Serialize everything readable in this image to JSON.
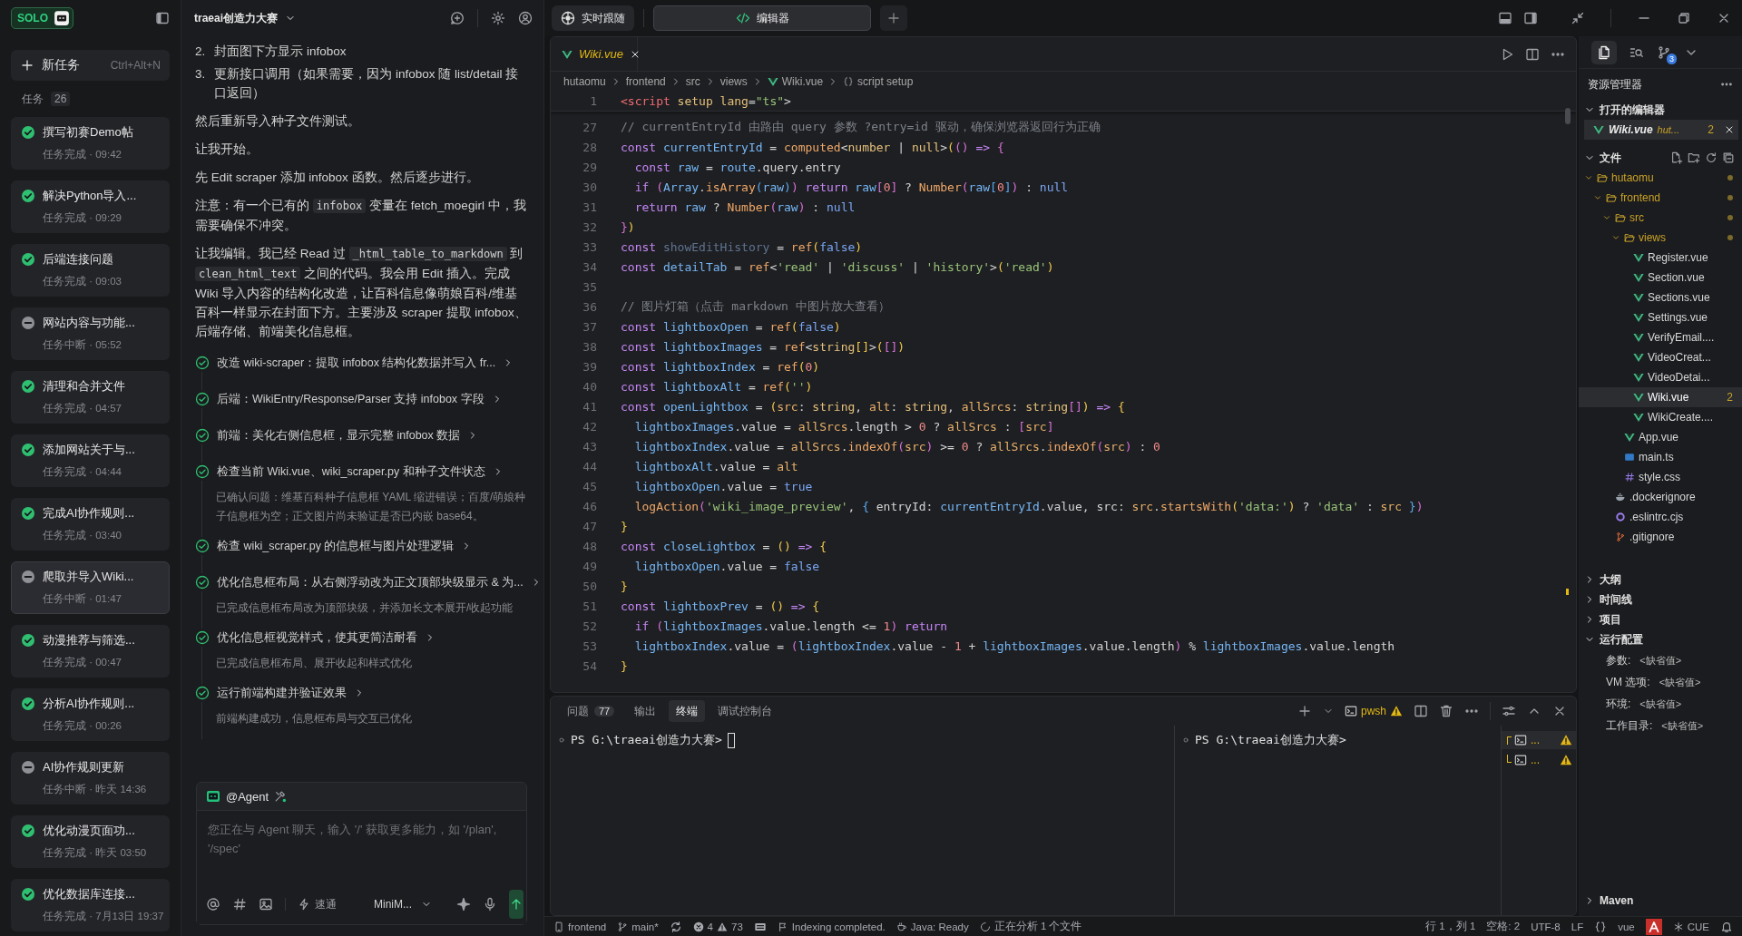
{
  "sidebar": {
    "logo": "SOLO",
    "new_task": {
      "label": "新任务",
      "shortcut": "Ctrl+Alt+N"
    },
    "tasks_label": "任务",
    "tasks_count": "26",
    "tasks": [
      {
        "title": "撰写初赛Demo帖",
        "kind": "done",
        "subtitle": "任务完成 · 09:42",
        "selected": false
      },
      {
        "title": "解决Python导入...",
        "kind": "done",
        "subtitle": "任务完成 · 09:29",
        "selected": false
      },
      {
        "title": "后端连接问题",
        "kind": "done",
        "subtitle": "任务完成 · 09:03",
        "selected": false
      },
      {
        "title": "网站内容与功能...",
        "kind": "interrupted",
        "subtitle": "任务中断 · 05:52",
        "selected": false
      },
      {
        "title": "清理和合并文件",
        "kind": "done",
        "subtitle": "任务完成 · 04:57",
        "selected": false
      },
      {
        "title": "添加网站关于与...",
        "kind": "done",
        "subtitle": "任务完成 · 04:44",
        "selected": false
      },
      {
        "title": "完成AI协作规则...",
        "kind": "done",
        "subtitle": "任务完成 · 03:40",
        "selected": false
      },
      {
        "title": "爬取并导入Wiki...",
        "kind": "interrupted",
        "subtitle": "任务中断 · 01:47",
        "selected": true
      },
      {
        "title": "动漫推荐与筛选...",
        "kind": "done",
        "subtitle": "任务完成 · 00:47",
        "selected": false
      },
      {
        "title": "分析AI协作规则...",
        "kind": "done",
        "subtitle": "任务完成 · 00:26",
        "selected": false
      },
      {
        "title": "AI协作规则更新",
        "kind": "interrupted",
        "subtitle": "任务中断 · 昨天 14:36",
        "selected": false
      },
      {
        "title": "优化动漫页面功...",
        "kind": "done",
        "subtitle": "任务完成 · 昨天 03:50",
        "selected": false
      },
      {
        "title": "优化数据库连接...",
        "kind": "done",
        "subtitle": "任务完成 · 7月13日 19:37",
        "selected": false
      }
    ]
  },
  "chat": {
    "title": "traeai创造力大赛",
    "messages": [
      {
        "kind": "numbered",
        "number": "2.",
        "text": "封面图下方显示 infobox"
      },
      {
        "kind": "numbered",
        "number": "3.",
        "text": "更新接口调用（如果需要，因为 infobox 随 list/detail 接口返回）"
      },
      {
        "kind": "paragraph",
        "parts": [
          {
            "kind": "text",
            "text": "然后重新导入种子文件测试。"
          }
        ]
      },
      {
        "kind": "paragraph",
        "parts": [
          {
            "kind": "text",
            "text": "让我开始。"
          }
        ]
      },
      {
        "kind": "paragraph",
        "parts": [
          {
            "kind": "text",
            "text": "先 Edit scraper 添加 infobox 函数。然后逐步进行。"
          }
        ]
      },
      {
        "kind": "paragraph",
        "parts": [
          {
            "kind": "text",
            "text": "注意：有一个已有的 "
          },
          {
            "kind": "code",
            "text": "infobox"
          },
          {
            "kind": "text",
            "text": " 变量在 fetch_moegirl 中，我需要确保不冲突。"
          }
        ]
      },
      {
        "kind": "paragraph",
        "parts": [
          {
            "kind": "text",
            "text": "让我编辑。我已经 Read 过 "
          },
          {
            "kind": "code",
            "text": "_html_table_to_markdown"
          },
          {
            "kind": "text",
            "text": " 到 "
          },
          {
            "kind": "code",
            "text": "clean_html_text"
          },
          {
            "kind": "text",
            "text": " 之间的代码。我会用 Edit 插入。完成 Wiki 导入内容的结构化改造，让百科信息像萌娘百科/维基百科一样显示在封面下方。主要涉及 scraper 提取 infobox、后端存储、前端美化信息框。"
          }
        ]
      }
    ],
    "steps": [
      {
        "title": "改造 wiki-scraper：提取 infobox 结构化数据并写入 fr..."
      },
      {
        "title": "后端：WikiEntry/Response/Parser 支持 infobox 字段"
      },
      {
        "title": "前端：美化右侧信息框，显示完整 infobox 数据"
      },
      {
        "title": "检查当前 Wiki.vue、wiki_scraper.py 和种子文件状态",
        "detail": "已确认问题：维基百科种子信息框 YAML 缩进错误；百度/萌娘种子信息框为空；正文图片尚未验证是否已内嵌 base64。"
      },
      {
        "title": "检查 wiki_scraper.py 的信息框与图片处理逻辑"
      },
      {
        "title": "优化信息框布局：从右侧浮动改为正文顶部块级显示 & 为...",
        "detail": "已完成信息框布局改为顶部块级，并添加长文本展开/收起功能"
      },
      {
        "title": "优化信息框视觉样式，使其更简洁耐看",
        "detail": "已完成信息框布局、展开收起和样式优化"
      },
      {
        "title": "运行前端构建并验证效果",
        "detail": "前端构建成功，信息框布局与交互已优化"
      }
    ],
    "composer": {
      "agent": "@Agent",
      "placeholder": "您正在与 Agent 聊天，输入 '/' 获取更多能力，如 '/plan', '/spec'",
      "mode": "速通",
      "model": "MiniM..."
    }
  },
  "top_bar": {
    "follow": "实时跟随",
    "tabs": [
      {
        "label": "编辑器",
        "selected": true
      }
    ]
  },
  "editor": {
    "tab": "Wiki.vue",
    "breadcrumb": [
      {
        "kind": "folder",
        "text": "hutaomu"
      },
      {
        "kind": "folder",
        "text": "frontend"
      },
      {
        "kind": "folder",
        "text": "src"
      },
      {
        "kind": "folder",
        "text": "views"
      },
      {
        "kind": "file",
        "text": "Wiki.vue"
      },
      {
        "kind": "symbol",
        "text": "script setup"
      }
    ],
    "sticky_line": {
      "number": "1",
      "tokens": [
        {
          "kind": "tg",
          "text": "<script"
        },
        {
          "kind": "at",
          "text": " setup"
        },
        {
          "kind": "at",
          "text": " lang"
        },
        {
          "kind": "p",
          "text": "="
        },
        {
          "kind": "s",
          "text": "\"ts\""
        },
        {
          "kind": "p",
          "text": ">"
        }
      ]
    },
    "lines": [
      {
        "number": "27",
        "tokens": [
          {
            "kind": "c",
            "text": "// currentEntryId 由路由 query 参数 ?entry=id 驱动，确保浏览器返回行为正确"
          }
        ]
      },
      {
        "number": "28",
        "tokens": [
          {
            "kind": "kw",
            "text": "const "
          },
          {
            "kind": "v",
            "text": "currentEntryId"
          },
          {
            "kind": "p",
            "text": " = "
          },
          {
            "kind": "f",
            "text": "computed"
          },
          {
            "kind": "p",
            "text": "<"
          },
          {
            "kind": "ty",
            "text": "number"
          },
          {
            "kind": "p",
            "text": " | "
          },
          {
            "kind": "ty",
            "text": "null"
          },
          {
            "kind": "p",
            "text": ">"
          },
          {
            "kind": "b1",
            "text": "("
          },
          {
            "kind": "b2",
            "text": "()"
          },
          {
            "kind": "kw",
            "text": " => "
          },
          {
            "kind": "b2",
            "text": "{"
          }
        ]
      },
      {
        "number": "29",
        "tokens": [
          {
            "kind": "kw",
            "text": "  const "
          },
          {
            "kind": "v",
            "text": "raw"
          },
          {
            "kind": "p",
            "text": " = "
          },
          {
            "kind": "v",
            "text": "route"
          },
          {
            "kind": "p",
            "text": ".query.entry"
          }
        ]
      },
      {
        "number": "30",
        "tokens": [
          {
            "kind": "kw",
            "text": "  if "
          },
          {
            "kind": "b2",
            "text": "("
          },
          {
            "kind": "v",
            "text": "Array"
          },
          {
            "kind": "p",
            "text": "."
          },
          {
            "kind": "f",
            "text": "isArray"
          },
          {
            "kind": "b3",
            "text": "("
          },
          {
            "kind": "v",
            "text": "raw"
          },
          {
            "kind": "b3",
            "text": ")"
          },
          {
            "kind": "b2",
            "text": ")"
          },
          {
            "kind": "kw",
            "text": " return "
          },
          {
            "kind": "v",
            "text": "raw"
          },
          {
            "kind": "b2",
            "text": "["
          },
          {
            "kind": "n",
            "text": "0"
          },
          {
            "kind": "b2",
            "text": "]"
          },
          {
            "kind": "p",
            "text": " ? "
          },
          {
            "kind": "f",
            "text": "Number"
          },
          {
            "kind": "b2",
            "text": "("
          },
          {
            "kind": "v",
            "text": "raw"
          },
          {
            "kind": "b3",
            "text": "["
          },
          {
            "kind": "n",
            "text": "0"
          },
          {
            "kind": "b3",
            "text": "]"
          },
          {
            "kind": "b2",
            "text": ")"
          },
          {
            "kind": "p",
            "text": " : "
          },
          {
            "kind": "l",
            "text": "null"
          }
        ]
      },
      {
        "number": "31",
        "tokens": [
          {
            "kind": "kw",
            "text": "  return "
          },
          {
            "kind": "v",
            "text": "raw"
          },
          {
            "kind": "p",
            "text": " ? "
          },
          {
            "kind": "f",
            "text": "Number"
          },
          {
            "kind": "b2",
            "text": "("
          },
          {
            "kind": "v",
            "text": "raw"
          },
          {
            "kind": "b2",
            "text": ")"
          },
          {
            "kind": "p",
            "text": " : "
          },
          {
            "kind": "l",
            "text": "null"
          }
        ]
      },
      {
        "number": "32",
        "tokens": [
          {
            "kind": "b2",
            "text": "}"
          },
          {
            "kind": "b1",
            "text": ")"
          }
        ]
      },
      {
        "number": "33",
        "tokens": [
          {
            "kind": "kw",
            "text": "const "
          },
          {
            "kind": "d",
            "text": "showEditHistory"
          },
          {
            "kind": "p",
            "text": " = "
          },
          {
            "kind": "f",
            "text": "ref"
          },
          {
            "kind": "b1",
            "text": "("
          },
          {
            "kind": "l",
            "text": "false"
          },
          {
            "kind": "b1",
            "text": ")"
          }
        ]
      },
      {
        "number": "34",
        "tokens": [
          {
            "kind": "kw",
            "text": "const "
          },
          {
            "kind": "v",
            "text": "detailTab"
          },
          {
            "kind": "p",
            "text": " = "
          },
          {
            "kind": "f",
            "text": "ref"
          },
          {
            "kind": "p",
            "text": "<"
          },
          {
            "kind": "s",
            "text": "'read'"
          },
          {
            "kind": "p",
            "text": " | "
          },
          {
            "kind": "s",
            "text": "'discuss'"
          },
          {
            "kind": "p",
            "text": " | "
          },
          {
            "kind": "s",
            "text": "'history'"
          },
          {
            "kind": "p",
            "text": ">"
          },
          {
            "kind": "b1",
            "text": "("
          },
          {
            "kind": "s",
            "text": "'read'"
          },
          {
            "kind": "b1",
            "text": ")"
          }
        ]
      },
      {
        "number": "35"
      },
      {
        "number": "36",
        "tokens": [
          {
            "kind": "c",
            "text": "// 图片灯箱（点击 markdown 中图片放大查看）"
          }
        ]
      },
      {
        "number": "37",
        "tokens": [
          {
            "kind": "kw",
            "text": "const "
          },
          {
            "kind": "v",
            "text": "lightboxOpen"
          },
          {
            "kind": "p",
            "text": " = "
          },
          {
            "kind": "f",
            "text": "ref"
          },
          {
            "kind": "b1",
            "text": "("
          },
          {
            "kind": "l",
            "text": "false"
          },
          {
            "kind": "b1",
            "text": ")"
          }
        ]
      },
      {
        "number": "38",
        "tokens": [
          {
            "kind": "kw",
            "text": "const "
          },
          {
            "kind": "v",
            "text": "lightboxImages"
          },
          {
            "kind": "p",
            "text": " = "
          },
          {
            "kind": "f",
            "text": "ref"
          },
          {
            "kind": "p",
            "text": "<"
          },
          {
            "kind": "ty",
            "text": "string"
          },
          {
            "kind": "b1",
            "text": "[]"
          },
          {
            "kind": "p",
            "text": ">"
          },
          {
            "kind": "b1",
            "text": "("
          },
          {
            "kind": "b2",
            "text": "[]"
          },
          {
            "kind": "b1",
            "text": ")"
          }
        ]
      },
      {
        "number": "39",
        "tokens": [
          {
            "kind": "kw",
            "text": "const "
          },
          {
            "kind": "v",
            "text": "lightboxIndex"
          },
          {
            "kind": "p",
            "text": " = "
          },
          {
            "kind": "f",
            "text": "ref"
          },
          {
            "kind": "b1",
            "text": "("
          },
          {
            "kind": "n",
            "text": "0"
          },
          {
            "kind": "b1",
            "text": ")"
          }
        ]
      },
      {
        "number": "40",
        "tokens": [
          {
            "kind": "kw",
            "text": "const "
          },
          {
            "kind": "v",
            "text": "lightboxAlt"
          },
          {
            "kind": "p",
            "text": " = "
          },
          {
            "kind": "f",
            "text": "ref"
          },
          {
            "kind": "b1",
            "text": "("
          },
          {
            "kind": "s",
            "text": "''"
          },
          {
            "kind": "b1",
            "text": ")"
          }
        ]
      },
      {
        "number": "41",
        "tokens": [
          {
            "kind": "kw",
            "text": "const "
          },
          {
            "kind": "v",
            "text": "openLightbox"
          },
          {
            "kind": "p",
            "text": " = "
          },
          {
            "kind": "b1",
            "text": "("
          },
          {
            "kind": "pr",
            "text": "src"
          },
          {
            "kind": "p",
            "text": ": "
          },
          {
            "kind": "ty",
            "text": "string"
          },
          {
            "kind": "p",
            "text": ", "
          },
          {
            "kind": "pr",
            "text": "alt"
          },
          {
            "kind": "p",
            "text": ": "
          },
          {
            "kind": "ty",
            "text": "string"
          },
          {
            "kind": "p",
            "text": ", "
          },
          {
            "kind": "pr",
            "text": "allSrcs"
          },
          {
            "kind": "p",
            "text": ": "
          },
          {
            "kind": "ty",
            "text": "string"
          },
          {
            "kind": "b2",
            "text": "[]"
          },
          {
            "kind": "b1",
            "text": ")"
          },
          {
            "kind": "kw",
            "text": " => "
          },
          {
            "kind": "b1",
            "text": "{"
          }
        ]
      },
      {
        "number": "42",
        "tokens": [
          {
            "kind": "v",
            "text": "  lightboxImages"
          },
          {
            "kind": "p",
            "text": ".value = "
          },
          {
            "kind": "pr",
            "text": "allSrcs"
          },
          {
            "kind": "p",
            "text": ".length > "
          },
          {
            "kind": "n",
            "text": "0"
          },
          {
            "kind": "p",
            "text": " ? "
          },
          {
            "kind": "pr",
            "text": "allSrcs"
          },
          {
            "kind": "p",
            "text": " : "
          },
          {
            "kind": "b2",
            "text": "["
          },
          {
            "kind": "pr",
            "text": "src"
          },
          {
            "kind": "b2",
            "text": "]"
          }
        ]
      },
      {
        "number": "43",
        "tokens": [
          {
            "kind": "v",
            "text": "  lightboxIndex"
          },
          {
            "kind": "p",
            "text": ".value = "
          },
          {
            "kind": "pr",
            "text": "allSrcs"
          },
          {
            "kind": "p",
            "text": "."
          },
          {
            "kind": "f",
            "text": "indexOf"
          },
          {
            "kind": "b2",
            "text": "("
          },
          {
            "kind": "pr",
            "text": "src"
          },
          {
            "kind": "b2",
            "text": ")"
          },
          {
            "kind": "p",
            "text": " >= "
          },
          {
            "kind": "n",
            "text": "0"
          },
          {
            "kind": "p",
            "text": " ? "
          },
          {
            "kind": "pr",
            "text": "allSrcs"
          },
          {
            "kind": "p",
            "text": "."
          },
          {
            "kind": "f",
            "text": "indexOf"
          },
          {
            "kind": "b2",
            "text": "("
          },
          {
            "kind": "pr",
            "text": "src"
          },
          {
            "kind": "b2",
            "text": ")"
          },
          {
            "kind": "p",
            "text": " : "
          },
          {
            "kind": "n",
            "text": "0"
          }
        ]
      },
      {
        "number": "44",
        "tokens": [
          {
            "kind": "v",
            "text": "  lightboxAlt"
          },
          {
            "kind": "p",
            "text": ".value = "
          },
          {
            "kind": "pr",
            "text": "alt"
          }
        ]
      },
      {
        "number": "45",
        "tokens": [
          {
            "kind": "v",
            "text": "  lightboxOpen"
          },
          {
            "kind": "p",
            "text": ".value = "
          },
          {
            "kind": "l",
            "text": "true"
          }
        ]
      },
      {
        "number": "46",
        "tokens": [
          {
            "kind": "f",
            "text": "  logAction"
          },
          {
            "kind": "b2",
            "text": "("
          },
          {
            "kind": "s",
            "text": "'wiki_image_preview'"
          },
          {
            "kind": "p",
            "text": ", "
          },
          {
            "kind": "b3",
            "text": "{"
          },
          {
            "kind": "p",
            "text": " entryId: "
          },
          {
            "kind": "v",
            "text": "currentEntryId"
          },
          {
            "kind": "p",
            "text": ".value, src: "
          },
          {
            "kind": "pr",
            "text": "src"
          },
          {
            "kind": "p",
            "text": "."
          },
          {
            "kind": "f",
            "text": "startsWith"
          },
          {
            "kind": "b1",
            "text": "("
          },
          {
            "kind": "s",
            "text": "'data:'"
          },
          {
            "kind": "b1",
            "text": ")"
          },
          {
            "kind": "p",
            "text": " ? "
          },
          {
            "kind": "s",
            "text": "'data'"
          },
          {
            "kind": "p",
            "text": " : "
          },
          {
            "kind": "pr",
            "text": "src"
          },
          {
            "kind": "b3",
            "text": " }"
          },
          {
            "kind": "b2",
            "text": ")"
          }
        ]
      },
      {
        "number": "47",
        "tokens": [
          {
            "kind": "b1",
            "text": "}"
          }
        ]
      },
      {
        "number": "48",
        "tokens": [
          {
            "kind": "kw",
            "text": "const "
          },
          {
            "kind": "v",
            "text": "closeLightbox"
          },
          {
            "kind": "p",
            "text": " = "
          },
          {
            "kind": "b1",
            "text": "()"
          },
          {
            "kind": "kw",
            "text": " => "
          },
          {
            "kind": "b1",
            "text": "{"
          }
        ]
      },
      {
        "number": "49",
        "tokens": [
          {
            "kind": "v",
            "text": "  lightboxOpen"
          },
          {
            "kind": "p",
            "text": ".value = "
          },
          {
            "kind": "l",
            "text": "false"
          }
        ]
      },
      {
        "number": "50",
        "tokens": [
          {
            "kind": "b1",
            "text": "}"
          }
        ]
      },
      {
        "number": "51",
        "tokens": [
          {
            "kind": "kw",
            "text": "const "
          },
          {
            "kind": "v",
            "text": "lightboxPrev"
          },
          {
            "kind": "p",
            "text": " = "
          },
          {
            "kind": "b1",
            "text": "()"
          },
          {
            "kind": "kw",
            "text": " => "
          },
          {
            "kind": "b1",
            "text": "{"
          }
        ]
      },
      {
        "number": "52",
        "tokens": [
          {
            "kind": "kw",
            "text": "  if "
          },
          {
            "kind": "b2",
            "text": "("
          },
          {
            "kind": "v",
            "text": "lightboxImages"
          },
          {
            "kind": "p",
            "text": ".value.length <= "
          },
          {
            "kind": "n",
            "text": "1"
          },
          {
            "kind": "b2",
            "text": ")"
          },
          {
            "kind": "kw",
            "text": " return"
          }
        ]
      },
      {
        "number": "53",
        "tokens": [
          {
            "kind": "v",
            "text": "  lightboxIndex"
          },
          {
            "kind": "p",
            "text": ".value = "
          },
          {
            "kind": "b2",
            "text": "("
          },
          {
            "kind": "v",
            "text": "lightboxIndex"
          },
          {
            "kind": "p",
            "text": ".value - "
          },
          {
            "kind": "n",
            "text": "1"
          },
          {
            "kind": "p",
            "text": " + "
          },
          {
            "kind": "v",
            "text": "lightboxImages"
          },
          {
            "kind": "p",
            "text": ".value.length"
          },
          {
            "kind": "b2",
            "text": ")"
          },
          {
            "kind": "p",
            "text": " % "
          },
          {
            "kind": "v",
            "text": "lightboxImages"
          },
          {
            "kind": "p",
            "text": ".value.length"
          }
        ]
      },
      {
        "number": "54",
        "tokens": [
          {
            "kind": "b1",
            "text": "}"
          }
        ]
      }
    ]
  },
  "panel": {
    "tabs": [
      {
        "label": "问题",
        "badge": "77",
        "selected": false
      },
      {
        "label": "输出",
        "selected": false
      },
      {
        "label": "终端",
        "selected": true
      },
      {
        "label": "调试控制台",
        "selected": false
      }
    ],
    "shell": "pwsh",
    "panes": [
      {
        "prompt": "PS G:\\traeai创造力大赛>",
        "cursor": true
      },
      {
        "prompt": "PS G:\\traeai创造力大赛>",
        "cursor": false
      }
    ],
    "terminals": [
      {
        "label": "..."
      },
      {
        "label": "..."
      }
    ]
  },
  "explorer": {
    "source_control_badge": "3",
    "title": "资源管理器",
    "open_editors": {
      "label": "打开的编辑器",
      "expanded": true,
      "items": [
        {
          "name": "Wiki.vue",
          "path": "hut...",
          "problems": "2"
        }
      ]
    },
    "files": {
      "label": "文件",
      "expanded": true,
      "tree": [
        {
          "name": "hutaomu",
          "kind": "folder",
          "expanded": true,
          "modified": true,
          "selected": false,
          "children": [
            {
              "name": "frontend",
              "kind": "folder",
              "expanded": true,
              "modified": true,
              "selected": false,
              "children": [
                {
                  "name": "src",
                  "kind": "folder",
                  "expanded": true,
                  "modified": true,
                  "selected": false,
                  "children": [
                    {
                      "name": "views",
                      "kind": "folder",
                      "expanded": true,
                      "modified": true,
                      "selected": false,
                      "children": [
                        {
                          "name": "Register.vue",
                          "kind": "vue",
                          "modified": false,
                          "selected": false
                        },
                        {
                          "name": "Section.vue",
                          "kind": "vue",
                          "modified": false,
                          "selected": false
                        },
                        {
                          "name": "Sections.vue",
                          "kind": "vue",
                          "modified": false,
                          "selected": false
                        },
                        {
                          "name": "Settings.vue",
                          "kind": "vue",
                          "modified": false,
                          "selected": false
                        },
                        {
                          "name": "VerifyEmail....",
                          "kind": "vue",
                          "modified": false,
                          "selected": false
                        },
                        {
                          "name": "VideoCreat...",
                          "kind": "vue",
                          "modified": false,
                          "selected": false
                        },
                        {
                          "name": "VideoDetai...",
                          "kind": "vue",
                          "modified": false,
                          "selected": false
                        },
                        {
                          "name": "Wiki.vue",
                          "kind": "vue",
                          "modified": false,
                          "selected": true,
                          "problems": "2"
                        },
                        {
                          "name": "WikiCreate....",
                          "kind": "vue",
                          "modified": false,
                          "selected": false
                        }
                      ]
                    },
                    {
                      "name": "App.vue",
                      "kind": "vue",
                      "modified": false,
                      "selected": false
                    },
                    {
                      "name": "main.ts",
                      "kind": "ts",
                      "modified": false,
                      "selected": false
                    },
                    {
                      "name": "style.css",
                      "kind": "css",
                      "modified": false,
                      "selected": false
                    }
                  ]
                },
                {
                  "name": ".dockerignore",
                  "kind": "docker",
                  "modified": false,
                  "selected": false
                },
                {
                  "name": ".eslintrc.cjs",
                  "kind": "eslint",
                  "modified": false,
                  "selected": false
                },
                {
                  "name": ".gitignore",
                  "kind": "git",
                  "modified": false,
                  "selected": false
                }
              ]
            }
          ]
        }
      ]
    },
    "sections": [
      {
        "label": "大纲",
        "expanded": false
      },
      {
        "label": "时间线",
        "expanded": false
      },
      {
        "label": "项目",
        "expanded": false
      },
      {
        "label": "运行配置",
        "expanded": true,
        "fields": [
          {
            "label": "参数:",
            "value": "<缺省值>"
          },
          {
            "label": "VM 选项:",
            "value": "<缺省值>"
          },
          {
            "label": "环境:",
            "value": "<缺省值>"
          },
          {
            "label": "工作目录:",
            "value": "<缺省值>"
          }
        ]
      }
    ],
    "bottom_section": {
      "label": "Maven",
      "expanded": false
    }
  },
  "status_bar": {
    "left": [
      {
        "kind": "workspace",
        "text": "frontend"
      },
      {
        "kind": "branch",
        "text": "main*"
      },
      {
        "kind": "sync"
      },
      {
        "kind": "problems",
        "errors": "4",
        "warnings": "73"
      },
      {
        "kind": "keyboard"
      },
      {
        "kind": "notice",
        "text": "Indexing completed."
      },
      {
        "kind": "java",
        "text": "Java: Ready"
      },
      {
        "kind": "progress",
        "text": "正在分析 1 个文件"
      }
    ],
    "right": [
      {
        "kind": "text",
        "text": "行 1，列 1"
      },
      {
        "kind": "text",
        "text": "空格: 2"
      },
      {
        "kind": "text",
        "text": "UTF-8"
      },
      {
        "kind": "text",
        "text": "LF"
      },
      {
        "kind": "braces"
      },
      {
        "kind": "text",
        "text": "vue"
      },
      {
        "kind": "alert"
      },
      {
        "kind": "cue",
        "text": "CUE"
      },
      {
        "kind": "bell"
      }
    ]
  }
}
